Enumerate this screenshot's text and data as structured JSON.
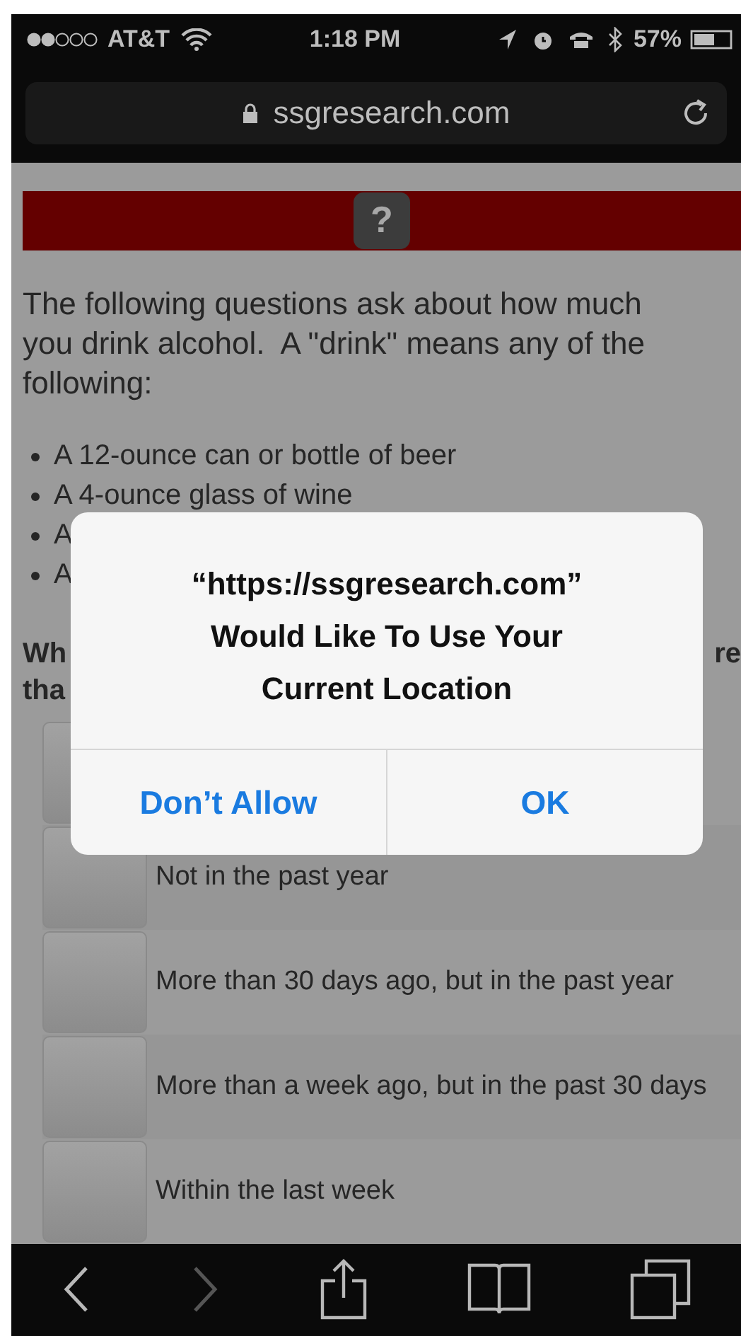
{
  "status_bar": {
    "carrier": "AT&T",
    "time": "1:18 PM",
    "battery": "57%"
  },
  "address_bar": {
    "url": "ssgresearch.com",
    "secure": true
  },
  "banner": {
    "help_icon": "?"
  },
  "intro": "The following questions ask about how much you drink alcohol.  A \"drink\" means any of the following:",
  "bullets": [
    "A 12-ounce can or bottle of beer",
    "A 4-ounce glass of wine",
    "A",
    "A"
  ],
  "question": {
    "left_lines": [
      "Wh",
      "tha"
    ],
    "right_part": "re"
  },
  "options": [
    {
      "kind": "covered",
      "selected": false
    },
    {
      "kind": "answer",
      "label": "Not in the past year",
      "selected": false
    },
    {
      "kind": "answer",
      "label": "More than 30 days ago, but in the past year",
      "selected": false
    },
    {
      "kind": "answer",
      "label": "More than a week ago, but in the past 30 days",
      "selected": false
    },
    {
      "kind": "answer",
      "label": "Within the last week",
      "selected": false
    }
  ],
  "alert": {
    "title_lines": [
      "“https://ssgresearch.com”",
      "Would Like To Use Your",
      "Current Location"
    ],
    "buttons": [
      "Don’t Allow",
      "OK"
    ]
  }
}
